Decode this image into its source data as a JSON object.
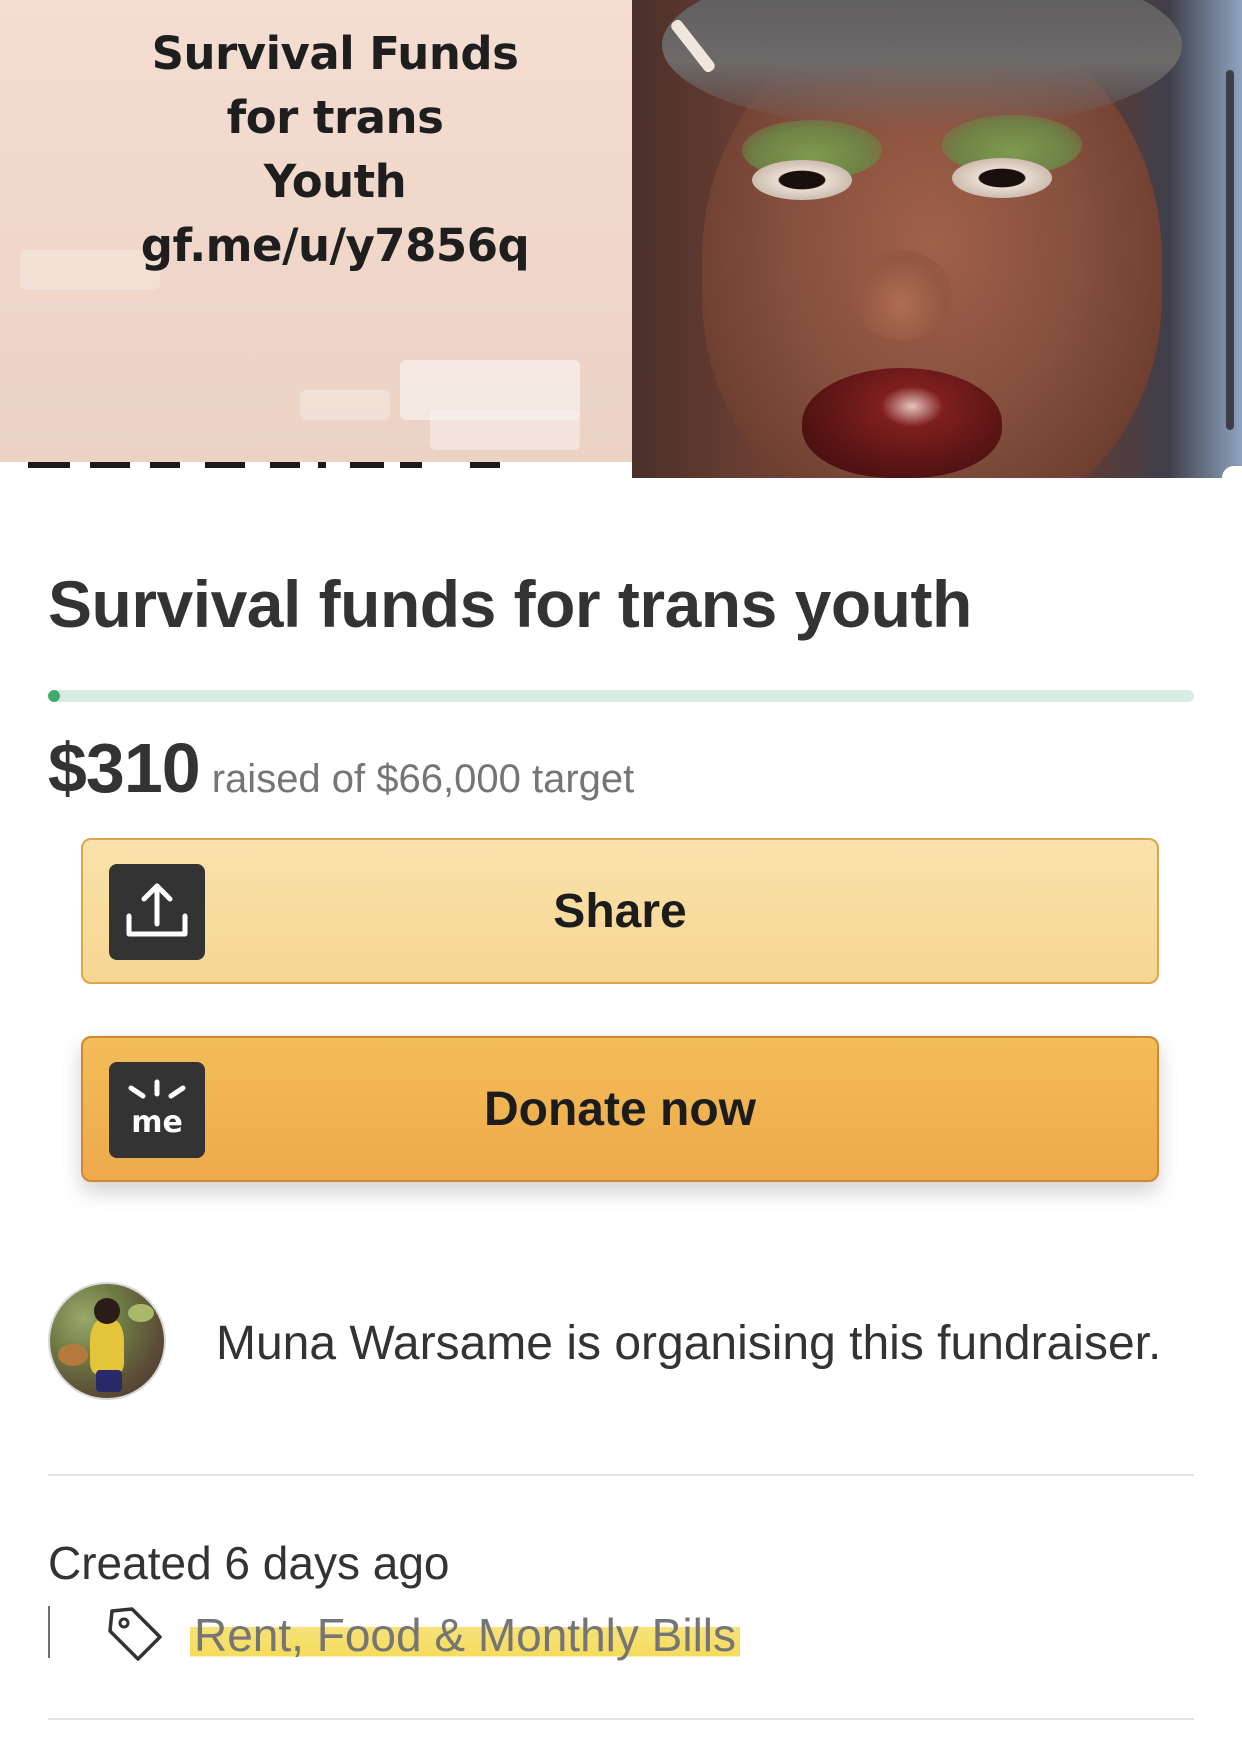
{
  "hero": {
    "image_text": [
      "Survival Funds",
      "for trans",
      "Youth",
      "gf.me/u/y7856q"
    ]
  },
  "campaign": {
    "title": "Survival funds for trans youth",
    "raised": "$310",
    "raised_suffix": "raised of $66,000 target",
    "progress_fraction": 0.0047
  },
  "buttons": {
    "share_label": "Share",
    "donate_label": "Donate now",
    "donate_icon_text": "me"
  },
  "organiser": {
    "text": "Muna Warsame is organising this fundraiser."
  },
  "meta": {
    "created": "Created 6 days ago",
    "category": "Rent, Food & Monthly Bills"
  },
  "colors": {
    "progress_track": "#d9ece1",
    "progress_fill": "#3eaa6a",
    "share_button": "#f8dc9d",
    "donate_button": "#f0b350",
    "highlight": "#f5dc5c"
  }
}
